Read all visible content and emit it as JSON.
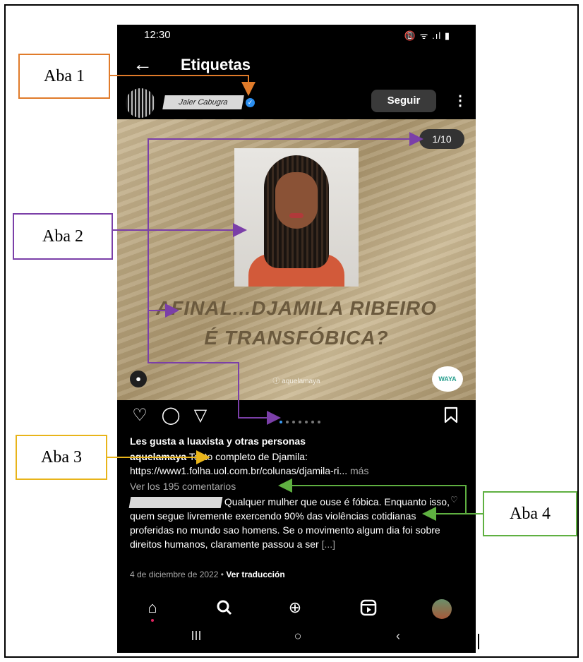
{
  "status_bar": {
    "time": "12:30",
    "right_icons": "📵 ᯤ .ıl ▮"
  },
  "header": {
    "back_icon": "←",
    "title": "Etiquetas"
  },
  "post_user": {
    "username": "Jaler Cabugra",
    "follow_label": "Seguir",
    "more_icon": "⋮"
  },
  "post_image": {
    "counter": "1/10",
    "headline_line1": "AFINAL...DJAMILA RIBEIRO",
    "headline_line2": "É TRANSFÓBICA?",
    "handle": "ⓘ aquelamaya",
    "logo_text": "WAYA"
  },
  "actions": {
    "like_icon": "♡",
    "comment_icon": "◯",
    "share_icon": "▽",
    "save_icon": "bookmark",
    "carousel_dots": 7
  },
  "likes_text": "Les gusta a luaxista y otras personas",
  "caption": {
    "username": "aquelamaya",
    "text": "Texto completo de Djamila:",
    "link": "https://www1.folha.uol.com.br/colunas/djamila-ri...",
    "more": "más"
  },
  "view_comments": "Ver los 195 comentarios",
  "comment": {
    "text": "Qualquer mulher que ouse é fóbica. Enquanto isso, quem segue livremente exercendo 90% das violências cotidianas proferidas no mundo sao homens. Se o movimento algum dia foi sobre direitos humanos, claramente passou a ser",
    "ellipsis": "[...]"
  },
  "date": {
    "text": "4 de diciembre de 2022",
    "separator": "•",
    "translate": "Ver traducción"
  },
  "bottom_nav": {
    "home": "⌂",
    "search": "🔍",
    "create": "⊕",
    "reels": "▶",
    "profile": "profile"
  },
  "system_nav": {
    "recents": "III",
    "home": "○",
    "back": "‹"
  },
  "annotations": {
    "aba1": "Aba 1",
    "aba2": "Aba 2",
    "aba3": "Aba 3",
    "aba4": "Aba 4",
    "colors": {
      "aba1": "#e07b2a",
      "aba2": "#7b3fa8",
      "aba3": "#e8b41a",
      "aba4": "#5fb041"
    }
  }
}
